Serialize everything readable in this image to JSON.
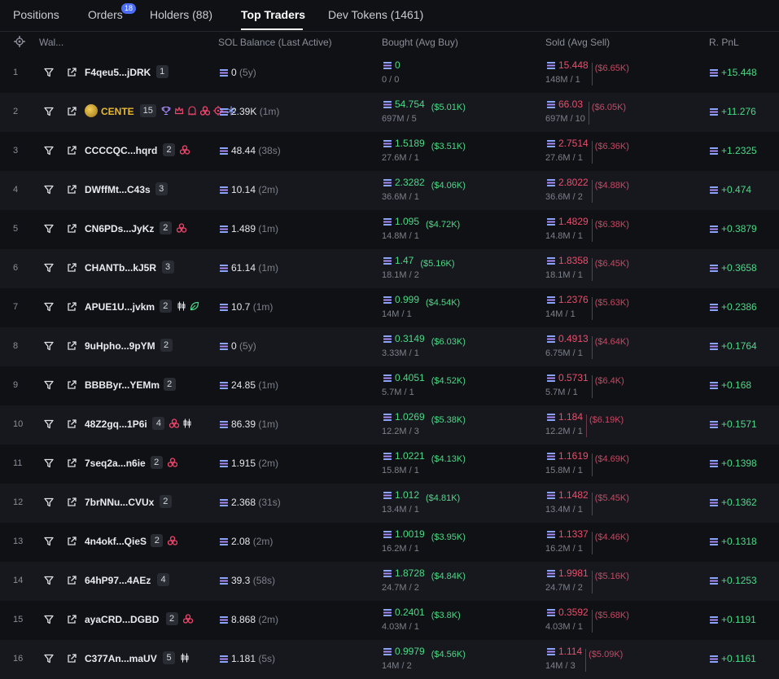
{
  "tabs": [
    {
      "label": "Positions"
    },
    {
      "label": "Orders",
      "badge": "18"
    },
    {
      "label": "Holders (88)"
    },
    {
      "label": "Top Traders"
    },
    {
      "label": "Dev Tokens (1461)"
    }
  ],
  "active_tab": "Top Traders",
  "columns": {
    "wallet": "Wal...",
    "sol_balance": "SOL Balance (Last Active)",
    "bought": "Bought (Avg Buy)",
    "sold": "Sold (Avg Sell)",
    "pnl": "R. PnL"
  },
  "colors": {
    "accent_green": "#4dd888",
    "accent_red": "#ef4c6c",
    "badge_blue": "#4c6ef5",
    "gold": "#e8b92f"
  },
  "rows": [
    {
      "rank": "1",
      "wallet": "F4qeu5...jDRK",
      "count": "1",
      "tags": [],
      "balance": "0",
      "last_active": "(5y)",
      "bought": "0",
      "bought_usd": "",
      "bought_sub": "0 / 0",
      "sold": "15.448",
      "sold_usd": "($6.65K)",
      "sold_sub": "148M / 1",
      "pnl": "+15.448"
    },
    {
      "rank": "2",
      "wallet": "CENTE",
      "gold": true,
      "count": "15",
      "tags": [
        "trophy-icon",
        "crown-icon",
        "ghost-icon",
        "cluster-icon",
        "target-icon",
        "snowflake-icon"
      ],
      "balance": "2.39K",
      "last_active": "(1m)",
      "bought": "54.754",
      "bought_usd": "($5.01K)",
      "bought_sub": "697M / 5",
      "sold": "66.03",
      "sold_usd": "($6.05K)",
      "sold_sub": "697M / 10",
      "pnl": "+11.276"
    },
    {
      "rank": "3",
      "wallet": "CCCCQC...hqrd",
      "count": "2",
      "tags": [
        "cluster-icon"
      ],
      "balance": "48.44",
      "last_active": "(38s)",
      "bought": "1.5189",
      "bought_usd": "($3.51K)",
      "bought_sub": "27.6M / 1",
      "sold": "2.7514",
      "sold_usd": "($6.36K)",
      "sold_sub": "27.6M / 1",
      "pnl": "+1.2325"
    },
    {
      "rank": "4",
      "wallet": "DWffMt...C43s",
      "count": "3",
      "tags": [],
      "balance": "10.14",
      "last_active": "(2m)",
      "bought": "2.3282",
      "bought_usd": "($4.06K)",
      "bought_sub": "36.6M / 1",
      "sold": "2.8022",
      "sold_usd": "($4.88K)",
      "sold_sub": "36.6M / 2",
      "pnl": "+0.474"
    },
    {
      "rank": "5",
      "wallet": "CN6PDs...JyKz",
      "count": "2",
      "tags": [
        "cluster-icon"
      ],
      "balance": "1.489",
      "last_active": "(1m)",
      "bought": "1.095",
      "bought_usd": "($4.72K)",
      "bought_sub": "14.8M / 1",
      "sold": "1.4829",
      "sold_usd": "($6.38K)",
      "sold_sub": "14.8M / 1",
      "pnl": "+0.3879"
    },
    {
      "rank": "6",
      "wallet": "CHANTb...kJ5R",
      "count": "3",
      "tags": [],
      "balance": "61.14",
      "last_active": "(1m)",
      "bought": "1.47",
      "bought_usd": "($5.16K)",
      "bought_sub": "18.1M / 2",
      "sold": "1.8358",
      "sold_usd": "($6.45K)",
      "sold_sub": "18.1M / 1",
      "pnl": "+0.3658"
    },
    {
      "rank": "7",
      "wallet": "APUE1U...jvkm",
      "count": "2",
      "tags": [
        "candles-icon",
        "leaf-icon"
      ],
      "balance": "10.7",
      "last_active": "(1m)",
      "bought": "0.999",
      "bought_usd": "($4.54K)",
      "bought_sub": "14M / 1",
      "sold": "1.2376",
      "sold_usd": "($5.63K)",
      "sold_sub": "14M / 1",
      "pnl": "+0.2386"
    },
    {
      "rank": "8",
      "wallet": "9uHpho...9pYM",
      "count": "2",
      "tags": [],
      "balance": "0",
      "last_active": "(5y)",
      "bought": "0.3149",
      "bought_usd": "($6.03K)",
      "bought_sub": "3.33M / 1",
      "sold": "0.4913",
      "sold_usd": "($4.64K)",
      "sold_sub": "6.75M / 1",
      "pnl": "+0.1764"
    },
    {
      "rank": "9",
      "wallet": "BBBByr...YEMm",
      "count": "2",
      "tags": [],
      "balance": "24.85",
      "last_active": "(1m)",
      "bought": "0.4051",
      "bought_usd": "($4.52K)",
      "bought_sub": "5.7M / 1",
      "sold": "0.5731",
      "sold_usd": "($6.4K)",
      "sold_sub": "5.7M / 1",
      "pnl": "+0.168"
    },
    {
      "rank": "10",
      "wallet": "48Z2gq...1P6i",
      "count": "4",
      "tags": [
        "cluster-icon",
        "candles-icon"
      ],
      "balance": "86.39",
      "last_active": "(1m)",
      "bought": "1.0269",
      "bought_usd": "($5.38K)",
      "bought_sub": "12.2M / 3",
      "sold": "1.184",
      "sold_usd": "($6.19K)",
      "sold_sub": "12.2M / 1",
      "pnl": "+0.1571"
    },
    {
      "rank": "11",
      "wallet": "7seq2a...n6ie",
      "count": "2",
      "tags": [
        "cluster-icon"
      ],
      "balance": "1.915",
      "last_active": "(2m)",
      "bought": "1.0221",
      "bought_usd": "($4.13K)",
      "bought_sub": "15.8M / 1",
      "sold": "1.1619",
      "sold_usd": "($4.69K)",
      "sold_sub": "15.8M / 1",
      "pnl": "+0.1398"
    },
    {
      "rank": "12",
      "wallet": "7brNNu...CVUx",
      "count": "2",
      "tags": [],
      "balance": "2.368",
      "last_active": "(31s)",
      "bought": "1.012",
      "bought_usd": "($4.81K)",
      "bought_sub": "13.4M / 1",
      "sold": "1.1482",
      "sold_usd": "($5.45K)",
      "sold_sub": "13.4M / 1",
      "pnl": "+0.1362"
    },
    {
      "rank": "13",
      "wallet": "4n4okf...QieS",
      "count": "2",
      "tags": [
        "cluster-icon"
      ],
      "balance": "2.08",
      "last_active": "(2m)",
      "bought": "1.0019",
      "bought_usd": "($3.95K)",
      "bought_sub": "16.2M / 1",
      "sold": "1.1337",
      "sold_usd": "($4.46K)",
      "sold_sub": "16.2M / 1",
      "pnl": "+0.1318"
    },
    {
      "rank": "14",
      "wallet": "64hP97...4AEz",
      "count": "4",
      "tags": [],
      "balance": "39.3",
      "last_active": "(58s)",
      "bought": "1.8728",
      "bought_usd": "($4.84K)",
      "bought_sub": "24.7M / 2",
      "sold": "1.9981",
      "sold_usd": "($5.16K)",
      "sold_sub": "24.7M / 2",
      "pnl": "+0.1253"
    },
    {
      "rank": "15",
      "wallet": "ayaCRD...DGBD",
      "count": "2",
      "tags": [
        "cluster-icon"
      ],
      "balance": "8.868",
      "last_active": "(2m)",
      "bought": "0.2401",
      "bought_usd": "($3.8K)",
      "bought_sub": "4.03M / 1",
      "sold": "0.3592",
      "sold_usd": "($5.68K)",
      "sold_sub": "4.03M / 1",
      "pnl": "+0.1191"
    },
    {
      "rank": "16",
      "wallet": "C377An...maUV",
      "count": "5",
      "tags": [
        "candles-icon"
      ],
      "balance": "1.181",
      "last_active": "(5s)",
      "bought": "0.9979",
      "bought_usd": "($4.56K)",
      "bought_sub": "14M / 2",
      "sold": "1.114",
      "sold_usd": "($5.09K)",
      "sold_sub": "14M / 3",
      "pnl": "+0.1161"
    }
  ]
}
